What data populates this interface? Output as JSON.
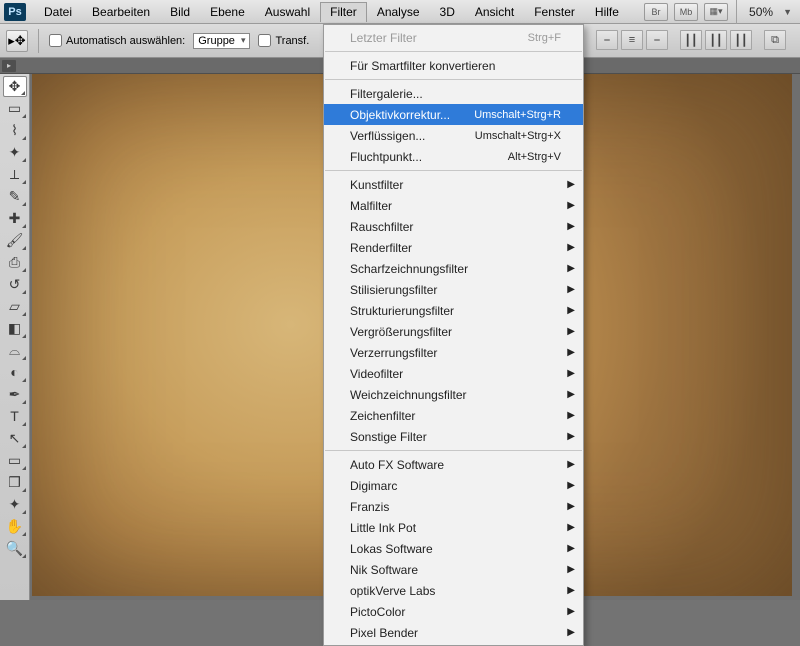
{
  "menubar": {
    "items": [
      "Datei",
      "Bearbeiten",
      "Bild",
      "Ebene",
      "Auswahl",
      "Filter",
      "Analyse",
      "3D",
      "Ansicht",
      "Fenster",
      "Hilfe"
    ],
    "open_index": 5,
    "right_buttons": [
      "Br",
      "Mb",
      "▦▾"
    ],
    "zoom": "50%"
  },
  "optionsbar": {
    "tool_glyph": "▸✥",
    "auto_select_label": "Automatisch auswählen:",
    "group_select": "Gruppe",
    "transform_label": "Transf."
  },
  "toolbox": {
    "tools": [
      {
        "name": "move",
        "glyph": "✥",
        "sel": true
      },
      {
        "name": "marquee",
        "glyph": "▭"
      },
      {
        "name": "lasso",
        "glyph": "⌇"
      },
      {
        "name": "wand",
        "glyph": "✦"
      },
      {
        "name": "crop",
        "glyph": "⟂"
      },
      {
        "name": "eyedrop",
        "glyph": "✎"
      },
      {
        "name": "heal",
        "glyph": "✚"
      },
      {
        "name": "brush",
        "glyph": "🖌"
      },
      {
        "name": "stamp",
        "glyph": "⎙"
      },
      {
        "name": "history",
        "glyph": "↺"
      },
      {
        "name": "eraser",
        "glyph": "▱"
      },
      {
        "name": "gradient",
        "glyph": "◧"
      },
      {
        "name": "blur",
        "glyph": "⌓"
      },
      {
        "name": "dodge",
        "glyph": "◐"
      },
      {
        "name": "pen",
        "glyph": "✒"
      },
      {
        "name": "type",
        "glyph": "T"
      },
      {
        "name": "path",
        "glyph": "↖"
      },
      {
        "name": "shape",
        "glyph": "▭"
      },
      {
        "name": "3d",
        "glyph": "❒"
      },
      {
        "name": "3dcam",
        "glyph": "✦"
      },
      {
        "name": "hand",
        "glyph": "✋"
      },
      {
        "name": "zoom",
        "glyph": "🔍"
      }
    ]
  },
  "dropdown": {
    "groups": [
      [
        {
          "label": "Letzter Filter",
          "shortcut": "Strg+F",
          "disabled": true
        }
      ],
      [
        {
          "label": "Für Smartfilter konvertieren"
        }
      ],
      [
        {
          "label": "Filtergalerie..."
        },
        {
          "label": "Objektivkorrektur...",
          "shortcut": "Umschalt+Strg+R",
          "highlight": true
        },
        {
          "label": "Verflüssigen...",
          "shortcut": "Umschalt+Strg+X"
        },
        {
          "label": "Fluchtpunkt...",
          "shortcut": "Alt+Strg+V"
        }
      ],
      [
        {
          "label": "Kunstfilter",
          "submenu": true
        },
        {
          "label": "Malfilter",
          "submenu": true
        },
        {
          "label": "Rauschfilter",
          "submenu": true
        },
        {
          "label": "Renderfilter",
          "submenu": true
        },
        {
          "label": "Scharfzeichnungsfilter",
          "submenu": true
        },
        {
          "label": "Stilisierungsfilter",
          "submenu": true
        },
        {
          "label": "Strukturierungsfilter",
          "submenu": true
        },
        {
          "label": "Vergrößerungsfilter",
          "submenu": true
        },
        {
          "label": "Verzerrungsfilter",
          "submenu": true
        },
        {
          "label": "Videofilter",
          "submenu": true
        },
        {
          "label": "Weichzeichnungsfilter",
          "submenu": true
        },
        {
          "label": "Zeichenfilter",
          "submenu": true
        },
        {
          "label": "Sonstige Filter",
          "submenu": true
        }
      ],
      [
        {
          "label": "Auto FX Software",
          "submenu": true
        },
        {
          "label": "Digimarc",
          "submenu": true
        },
        {
          "label": "Franzis",
          "submenu": true
        },
        {
          "label": "Little Ink Pot",
          "submenu": true
        },
        {
          "label": "Lokas Software",
          "submenu": true
        },
        {
          "label": "Nik Software",
          "submenu": true
        },
        {
          "label": "optikVerve Labs",
          "submenu": true
        },
        {
          "label": "PictoColor",
          "submenu": true
        },
        {
          "label": "Pixel Bender",
          "submenu": true
        }
      ]
    ]
  }
}
